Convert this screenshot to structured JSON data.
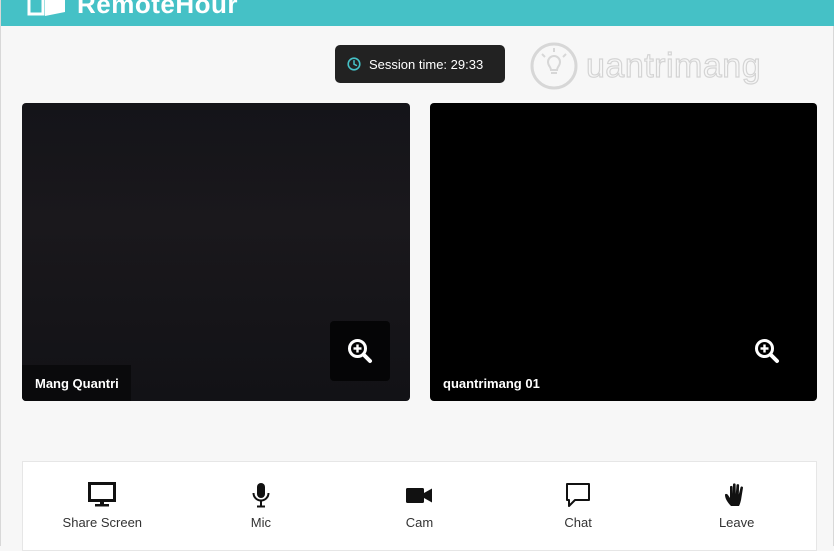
{
  "app": {
    "brand_name": "RemoteHour",
    "accent_color": "#45c1c6"
  },
  "session": {
    "label": "Session time: 29:33",
    "icon": "clock-icon"
  },
  "watermark": {
    "text": "uantrimang",
    "icon": "lightbulb-icon"
  },
  "videos": [
    {
      "participant": "Mang Quantri",
      "zoom_icon": "zoom-in-icon"
    },
    {
      "participant": "quantrimang 01",
      "zoom_icon": "zoom-in-icon"
    }
  ],
  "toolbar": {
    "items": [
      {
        "label": "Share Screen",
        "icon": "monitor-icon"
      },
      {
        "label": "Mic",
        "icon": "microphone-icon"
      },
      {
        "label": "Cam",
        "icon": "video-camera-icon"
      },
      {
        "label": "Chat",
        "icon": "chat-bubble-icon"
      },
      {
        "label": "Leave",
        "icon": "raised-hand-icon"
      }
    ]
  }
}
